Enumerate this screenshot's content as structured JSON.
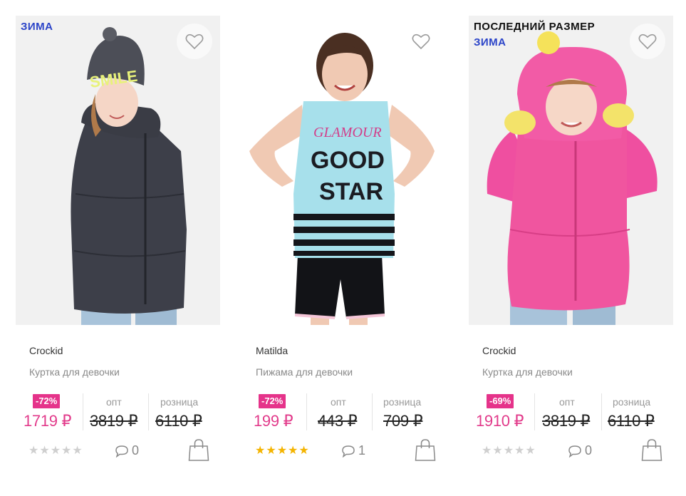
{
  "currency": "₽",
  "labels": {
    "wholesale": "опт",
    "retail": "розница"
  },
  "products": [
    {
      "badges": [
        "ЗИМА"
      ],
      "brand": "Crockid",
      "name": "Куртка для девочки",
      "discount": "-72%",
      "price": "1719 ₽",
      "wholesale_price": "3819 ₽",
      "retail_price": "6110 ₽",
      "rating": 0,
      "comments": "0"
    },
    {
      "badges": [],
      "brand": "Matilda",
      "name": "Пижама для девочки",
      "discount": "-72%",
      "price": "199 ₽",
      "wholesale_price": "443 ₽",
      "retail_price": "709 ₽",
      "rating": 5,
      "comments": "1"
    },
    {
      "badges": [
        "ПОСЛЕДНИЙ РАЗМЕР",
        "ЗИМА"
      ],
      "brand": "Crockid",
      "name": "Куртка для девочки",
      "discount": "-69%",
      "price": "1910 ₽",
      "wholesale_price": "3819 ₽",
      "retail_price": "6110 ₽",
      "rating": 0,
      "comments": "0"
    }
  ],
  "colors": {
    "accent_pink": "#e5338a",
    "season_blue": "#2a43c8",
    "star_gold": "#f4b400",
    "star_empty": "#cfcfcf"
  },
  "icons": [
    "heart-icon",
    "comment-icon",
    "shopping-bag-icon",
    "star-icon"
  ]
}
